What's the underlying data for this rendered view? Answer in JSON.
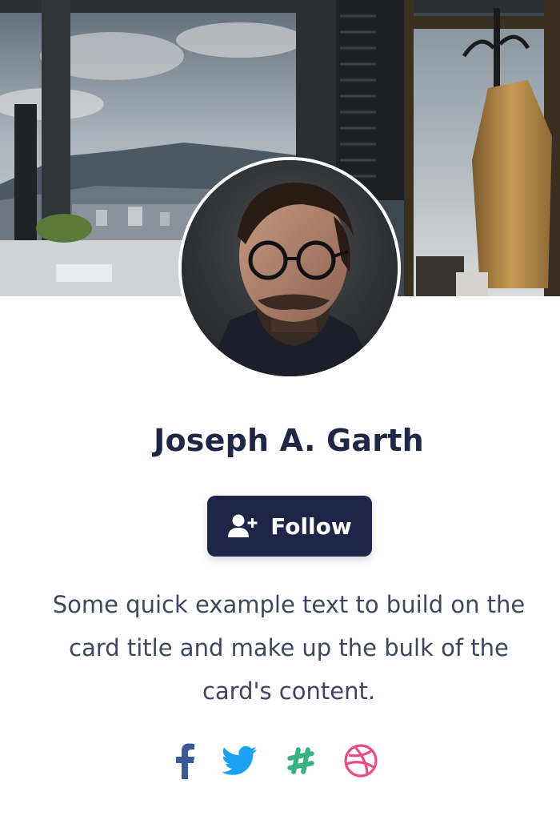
{
  "profile": {
    "name": "Joseph A. Garth",
    "description": "Some quick example text to build on the card title and make up the bulk of the card's content."
  },
  "follow_button": {
    "label": "Follow",
    "icon": "user-plus-icon"
  },
  "social": [
    {
      "name": "facebook",
      "icon": "facebook-icon",
      "color": "#3b5998"
    },
    {
      "name": "twitter",
      "icon": "twitter-icon",
      "color": "#1da1f2"
    },
    {
      "name": "slack",
      "icon": "slack-icon",
      "color": "#36b37e"
    },
    {
      "name": "dribbble",
      "icon": "dribbble-icon",
      "color": "#ea4c89"
    }
  ],
  "colors": {
    "primary": "#1e2547",
    "name_text": "#202744",
    "body_text": "#3f4560"
  }
}
